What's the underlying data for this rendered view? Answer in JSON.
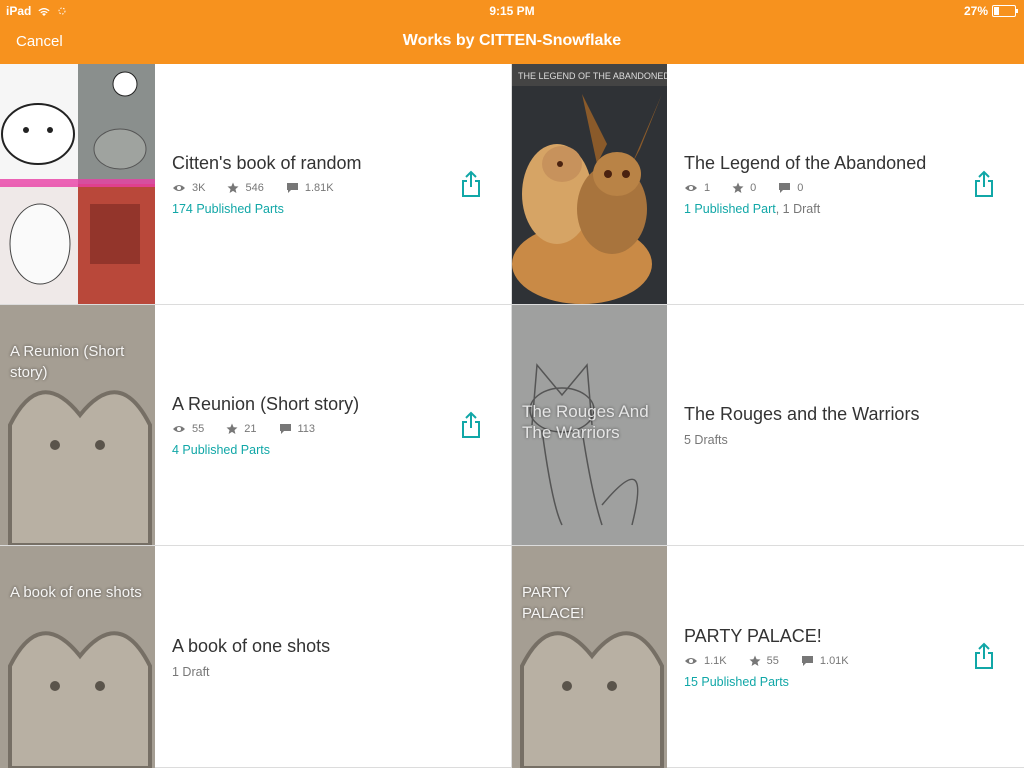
{
  "status": {
    "device": "iPad",
    "time": "9:15 PM",
    "battery_text": "27%",
    "battery_level": 0.27
  },
  "nav": {
    "cancel_label": "Cancel",
    "title": "Works by CITTEN-Snowflake"
  },
  "works": [
    {
      "title": "Citten's book of random",
      "views": "3K",
      "votes": "546",
      "comments": "1.81K",
      "published": "174 Published Parts",
      "drafts": "",
      "cover_text": "",
      "shareable": true
    },
    {
      "title": "The Legend of the Abandoned",
      "views": "1",
      "votes": "0",
      "comments": "0",
      "published": "1 Published Part",
      "drafts": ", 1 Draft",
      "cover_text": "",
      "shareable": true
    },
    {
      "title": "A Reunion (Short story)",
      "views": "55",
      "votes": "21",
      "comments": "113",
      "published": "4 Published Parts",
      "drafts": "",
      "cover_text": "A Reunion (Short story)",
      "shareable": true
    },
    {
      "title": "The Rouges and the Warriors",
      "published": "",
      "drafts": "5 Drafts",
      "cover_text": "The Rouges And The Warriors",
      "shareable": false
    },
    {
      "title": "A book of one shots",
      "published": "",
      "drafts": "1 Draft",
      "cover_text": "A book of one shots",
      "shareable": false
    },
    {
      "title": "PARTY PALACE!",
      "views": "1.1K",
      "votes": "55",
      "comments": "1.01K",
      "published": "15 Published Parts",
      "drafts": "",
      "cover_text": "PARTY PALACE!",
      "shareable": true
    }
  ],
  "colors": {
    "brand": "#f7921e",
    "accent": "#11a7a7"
  }
}
